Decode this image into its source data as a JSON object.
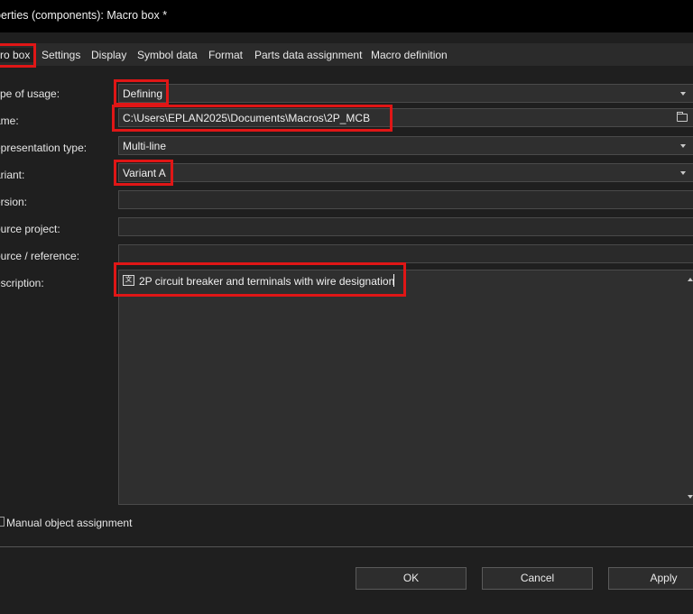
{
  "window": {
    "title": "perties (components): Macro box *"
  },
  "tabs": [
    {
      "label": "ro box",
      "active": true
    },
    {
      "label": "Settings"
    },
    {
      "label": "Display"
    },
    {
      "label": "Symbol data"
    },
    {
      "label": "Format"
    },
    {
      "label": "Parts data assignment"
    },
    {
      "label": "Macro definition"
    }
  ],
  "fields": {
    "type_of_usage": {
      "label": "ype of usage:",
      "value": "Defining"
    },
    "name": {
      "label": "ame:",
      "value": "C:\\Users\\EPLAN2025\\Documents\\Macros\\2P_MCB"
    },
    "representation_type": {
      "label": "epresentation type:",
      "value": "Multi-line"
    },
    "variant": {
      "label": "ariant:",
      "value": "Variant A"
    },
    "version": {
      "label": "ersion:",
      "value": ""
    },
    "source_project": {
      "label": "ource project:",
      "value": ""
    },
    "source_reference": {
      "label": "ource / reference:",
      "value": ""
    },
    "description": {
      "label": "escription:",
      "value": "2P circuit breaker and terminals with wire designation",
      "lang_icon": "language-icon"
    }
  },
  "options": {
    "manual_object_assignment": {
      "label": "Manual object assignment",
      "checked": false
    }
  },
  "buttons": {
    "ok": "OK",
    "cancel": "Cancel",
    "apply": "Apply"
  },
  "colors": {
    "highlight": "#e01616",
    "background": "#1f1f1f",
    "field": "#2f2f2f"
  }
}
